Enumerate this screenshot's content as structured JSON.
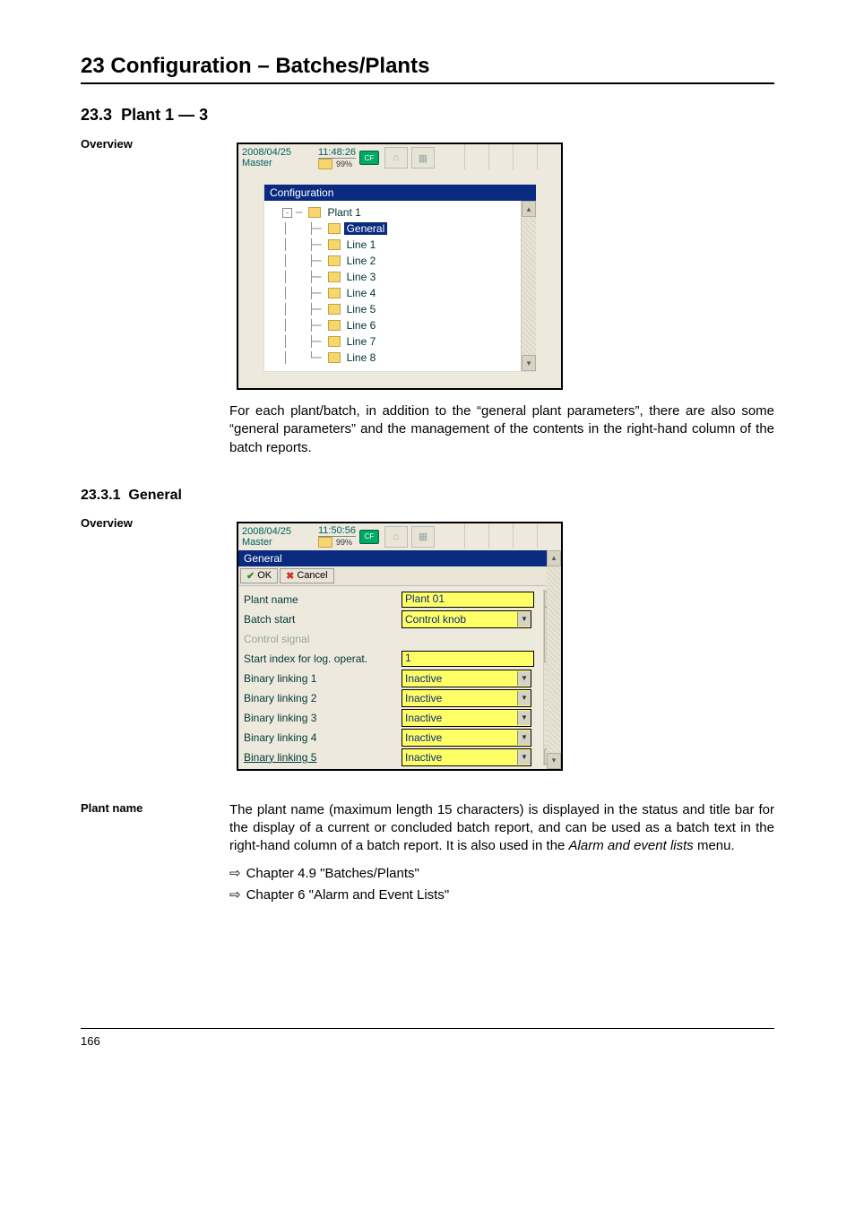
{
  "chapter": {
    "title": "23 Configuration – Batches/Plants"
  },
  "section": {
    "number": "23.3",
    "title": "Plant 1 — 3"
  },
  "overview1": {
    "label": "Overview",
    "device": {
      "date": "2008/04/25",
      "mode": "Master",
      "time": "11:48:26",
      "cf": "CF",
      "pct": "99%"
    },
    "tree": {
      "title": "Configuration",
      "root": "Plant 1",
      "selected": "General",
      "items": [
        "Line 1",
        "Line 2",
        "Line 3",
        "Line 4",
        "Line 5",
        "Line 6",
        "Line 7",
        "Line 8"
      ]
    },
    "paragraph": "For each plant/batch, in addition to the “general plant parameters”, there are also some “general parameters” and the management of the contents in the right-hand column of the batch reports."
  },
  "subsection": {
    "number": "23.3.1",
    "title": "General"
  },
  "overview2": {
    "label": "Overview",
    "device": {
      "date": "2008/04/25",
      "mode": "Master",
      "time": "11:50:56",
      "cf": "CF",
      "pct": "99%"
    },
    "form": {
      "title": "General",
      "ok": "OK",
      "cancel": "Cancel",
      "rows": [
        {
          "label": "Plant name",
          "type": "text",
          "value": "Plant 01"
        },
        {
          "label": "Batch start",
          "type": "select",
          "value": "Control knob"
        },
        {
          "label": "Control signal",
          "type": "disabled"
        },
        {
          "label": "Start index for log. operat.",
          "type": "text",
          "value": "1"
        },
        {
          "label": "Binary linking 1",
          "type": "select",
          "value": "Inactive"
        },
        {
          "label": "Binary linking 2",
          "type": "select",
          "value": "Inactive"
        },
        {
          "label": "Binary linking 3",
          "type": "select",
          "value": "Inactive"
        },
        {
          "label": "Binary linking 4",
          "type": "select",
          "value": "Inactive"
        },
        {
          "label": "Binary linking 5",
          "type": "select",
          "value": "Inactive",
          "last": true
        }
      ]
    }
  },
  "plantname": {
    "label": "Plant name",
    "text_pre": "The plant name (maximum length 15 characters) is displayed in the status and title bar for the display of a current or concluded batch report, and can be used as a batch text in the right-hand column of a batch report. It is also used in the ",
    "text_em": "Alarm and event lists",
    "text_post": " menu.",
    "refs": [
      "Chapter 4.9 \"Batches/Plants\"",
      "Chapter 6 \"Alarm and Event Lists\""
    ]
  },
  "footer": {
    "page": "166"
  }
}
